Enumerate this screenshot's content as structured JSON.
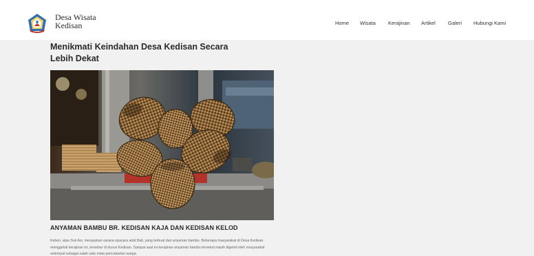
{
  "header": {
    "brand_line1": "Desa Wisata",
    "brand_line2": "Kedisan",
    "logo_icon": "village-emblem-icon",
    "nav": [
      "Home",
      "Wisata",
      "Kerajinan",
      "Artikel",
      "Galeri",
      "Hubungi Kami"
    ]
  },
  "main": {
    "title_line1": "Menikmati Keindahan Desa Kedisan Secara",
    "title_line2": "Lebih Dekat",
    "image_alt": "bamboo-baskets-photo",
    "article_heading": "ANYAMAN BAMBU BR. KEDISAN KAJA DAN KEDISAN KELOD",
    "article_body": "Keben, atau Sok Asi, merupakan sarana upacara adat Bali, yang terbuat dari anyaman bambu. Beberapa masyarakat di Desa Kedisan menggeluti kerajinan ini, tersebar di dusun Kedisan. Sampai saat ini kerajinan anyaman bambu tersebut masih digeluti oleh masyarakat setempat sebagai salah satu mata pencaharian warga."
  },
  "colors": {
    "background": "#f1f1f1",
    "header_bg": "#ffffff",
    "logo_blue": "#2f6fb0",
    "logo_red": "#c0392b"
  }
}
